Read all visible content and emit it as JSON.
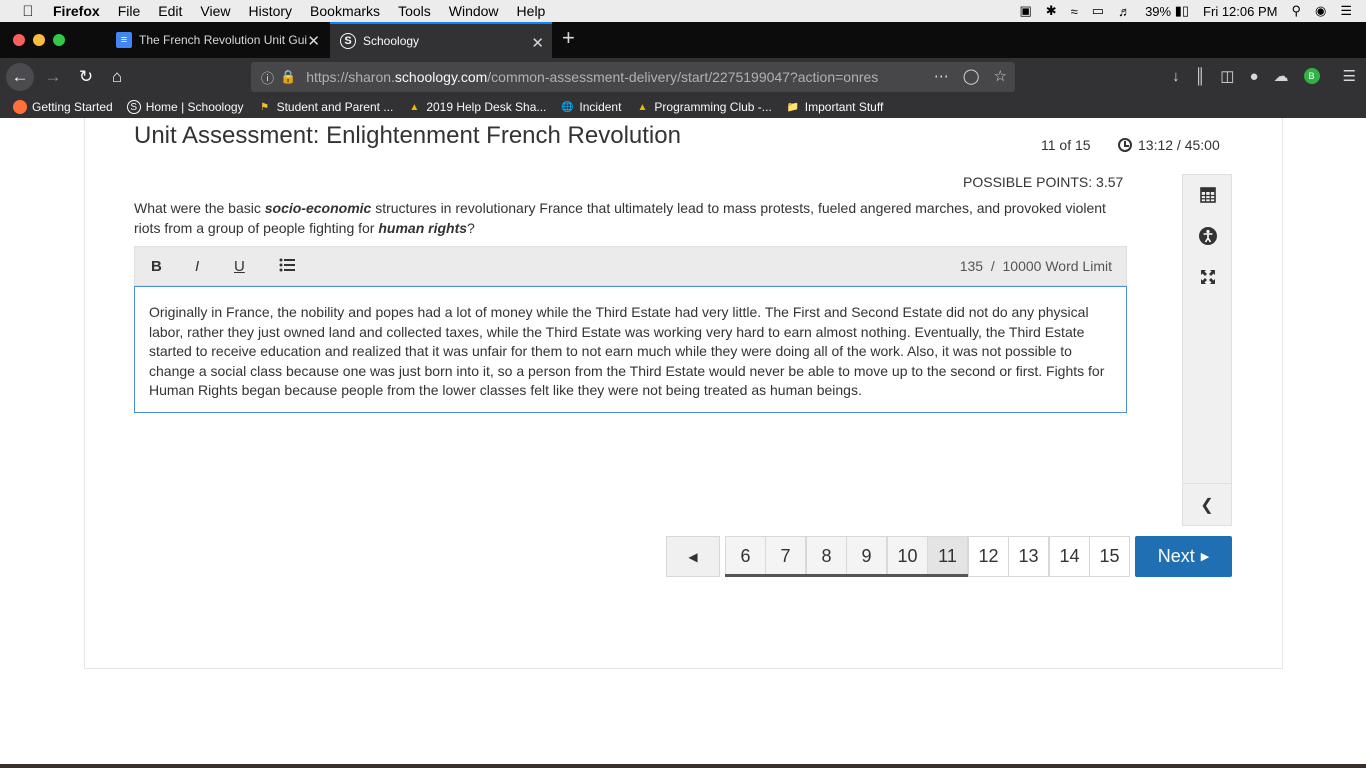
{
  "menubar": {
    "app": "Firefox",
    "items": [
      "File",
      "Edit",
      "View",
      "History",
      "Bookmarks",
      "Tools",
      "Window",
      "Help"
    ],
    "battery": "39%",
    "clock": "Fri 12:06 PM"
  },
  "tabs": [
    {
      "title": "The French Revolution Unit Gui",
      "icon": "docs-icon"
    },
    {
      "title": "Schoology",
      "icon": "schoology-icon"
    }
  ],
  "url": {
    "prefix": "https://sharon.",
    "domain": "schoology.com",
    "path": "/common-assessment-delivery/start/2275199047?action=onres"
  },
  "bookmarks": [
    {
      "label": "Getting Started"
    },
    {
      "label": "Home | Schoology"
    },
    {
      "label": "Student and Parent ..."
    },
    {
      "label": "2019 Help Desk Sha..."
    },
    {
      "label": "Incident"
    },
    {
      "label": "Programming Club -..."
    },
    {
      "label": "Important Stuff"
    }
  ],
  "assessment": {
    "title": "Unit Assessment: Enlightenment French Revolution",
    "counter": "11 of 15",
    "timer": "13:12 / 45:00",
    "points": "POSSIBLE POINTS: 3.57",
    "question_parts": {
      "p1": "What were the basic ",
      "em1": "socio-economic",
      "p2": " structures in revolutionary France that ultimately lead to mass protests, fueled angered marches, and provoked violent riots from a group of people fighting for ",
      "em2": "human rights",
      "p3": "?"
    },
    "editor": {
      "bold": "B",
      "italic": "I",
      "underline": "U",
      "word_limit": "135  /  10000 Word Limit",
      "answer": "Originally in France, the nobility and popes had a lot of money while the Third Estate had very little. The First and Second Estate did not do any physical labor, rather they just owned land and collected taxes, while the Third Estate was working very hard to earn almost nothing. Eventually, the Third Estate started to receive education and realized that it was unfair for them to not earn much while they were doing all of the work. Also, it was not possible to change a social class because one was just born into it, so a person from the Third Estate would never be able to move up to the second or first. Fights for Human Rights began because people from the lower classes felt like they were not being treated as human beings."
    },
    "pagination": {
      "pages": [
        "6",
        "7",
        "8",
        "9",
        "10",
        "11",
        "12",
        "13",
        "14",
        "15"
      ],
      "current": "11",
      "next_label": "Next"
    }
  },
  "colors": {
    "accent": "#1f6fb2",
    "editor_border": "#4a8fd6"
  }
}
